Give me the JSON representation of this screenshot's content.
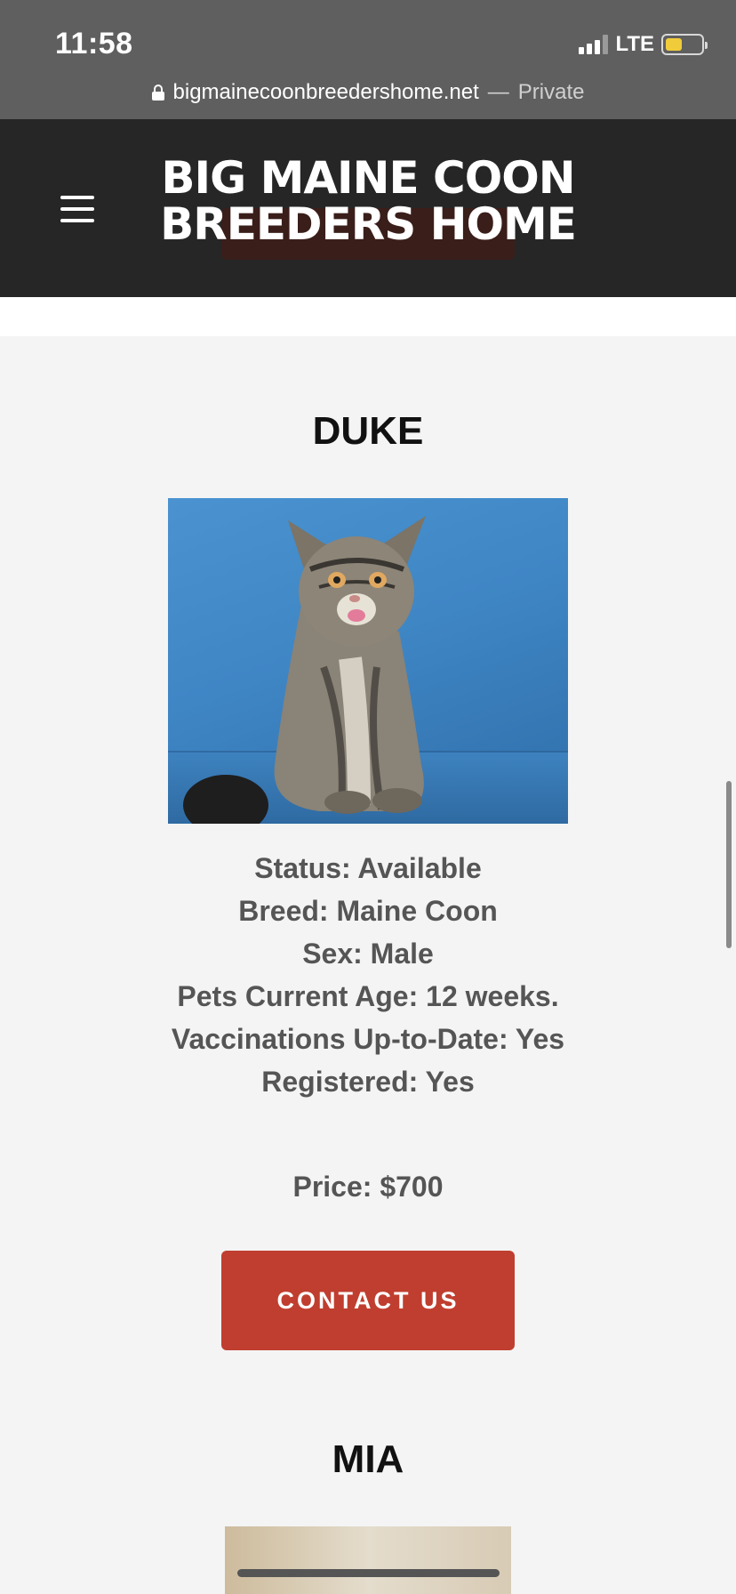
{
  "status_bar": {
    "time": "11:58",
    "network": "LTE",
    "battery_color": "#f1cc3a"
  },
  "url_bar": {
    "host": "bigmainecoonbreedershome.net",
    "separator": "—",
    "mode": "Private"
  },
  "header": {
    "brand_line1": "BIG MAINE COON",
    "brand_line2": "BREEDERS HOME",
    "menu_icon": "hamburger-icon"
  },
  "pets": [
    {
      "name": "DUKE",
      "details": [
        "Status: Available",
        "Breed: Maine Coon",
        "Sex: Male",
        "Pets Current Age: 12 weeks.",
        "Vaccinations Up-to-Date: Yes",
        "Registered: Yes"
      ],
      "price": "Price: $700",
      "cta": "CONTACT US"
    },
    {
      "name": "MIA"
    }
  ],
  "colors": {
    "header_bg": "#262626",
    "cta_bg": "#c03e2f",
    "page_bg": "#f4f4f4"
  }
}
